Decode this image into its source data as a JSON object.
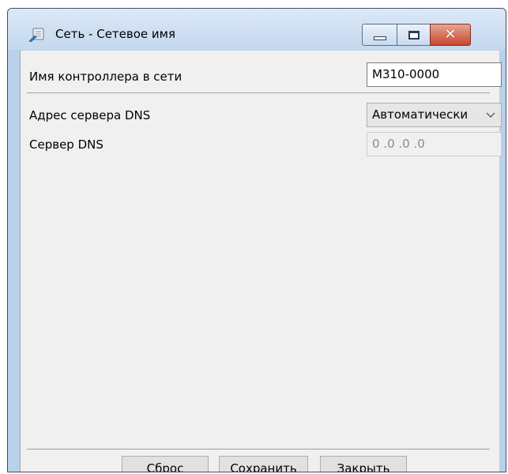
{
  "window": {
    "title": "Сеть - Сетевое имя",
    "icon": "network-settings-icon"
  },
  "titlebar_buttons": {
    "minimize_icon": "minimize-icon",
    "maximize_icon": "maximize-icon",
    "close_icon": "close-icon",
    "close_glyph": "✕"
  },
  "form": {
    "controller_name": {
      "label": "Имя контроллера в сети",
      "value": "М310-0000"
    },
    "dns_mode": {
      "label": "Адрес сервера DNS",
      "selected": "Автоматически"
    },
    "dns_server": {
      "label": "Сервер DNS",
      "value": "0 .0 .0 .0"
    }
  },
  "buttons": {
    "reset": "Сброс",
    "save": "Сохранить",
    "close": "Закрыть"
  },
  "colors": {
    "titlebar": "#c4d8ee",
    "close_button": "#c8462c",
    "client_bg": "#f0f0f0"
  }
}
